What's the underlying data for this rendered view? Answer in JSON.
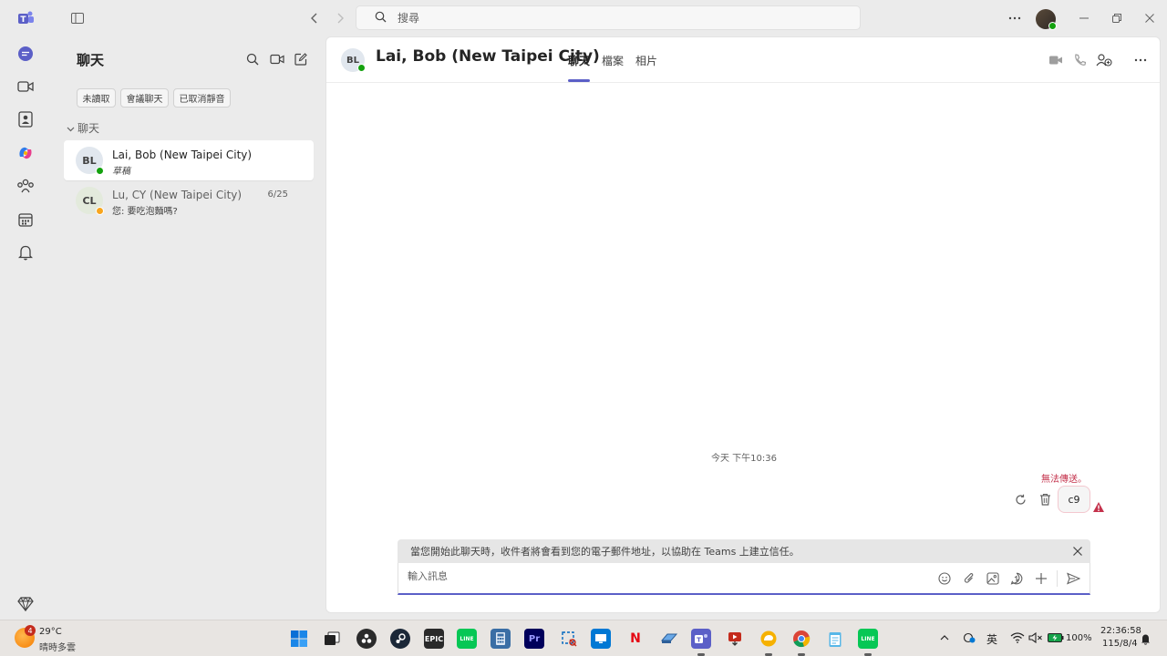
{
  "search": {
    "placeholder": "搜尋"
  },
  "chat_list": {
    "title": "聊天",
    "filters": [
      "未讀取",
      "會議聊天",
      "已取消靜音"
    ],
    "section_label": "聊天",
    "items": [
      {
        "initials": "BL",
        "name": "Lai, Bob (New Taipei City)",
        "preview": "草稿",
        "time": "",
        "presence": "available"
      },
      {
        "initials": "CL",
        "name": "Lu, CY (New Taipei City)",
        "preview": "您: 要吃泡麵嗎?",
        "time": "6/25",
        "presence": "away"
      }
    ]
  },
  "conversation": {
    "initials": "BL",
    "name": "Lai, Bob (New Taipei City)",
    "tabs": [
      "聊天",
      "檔案",
      "相片"
    ],
    "timestamp": "今天 下午10:36",
    "fail_text": "無法傳送。",
    "message": "c9",
    "notice": "當您開始此聊天時，收件者將會看到您的電子郵件地址，以協助在 Teams 上建立信任。",
    "compose_placeholder": "輸入訊息"
  },
  "taskbar": {
    "weather_badge": "4",
    "weather_temp": "29°C",
    "weather_desc": "晴時多雲",
    "epic_label": "EPIC",
    "premiere_label": "Pr",
    "netflix_label": "N",
    "line_label": "LINE",
    "ime": "英",
    "battery": "100%",
    "time": "22:36:58",
    "date": "115/8/4"
  },
  "colors": {
    "accent": "#5b5fc7",
    "error": "#c4314b",
    "available": "#13a10e",
    "away": "#f8a51d"
  }
}
